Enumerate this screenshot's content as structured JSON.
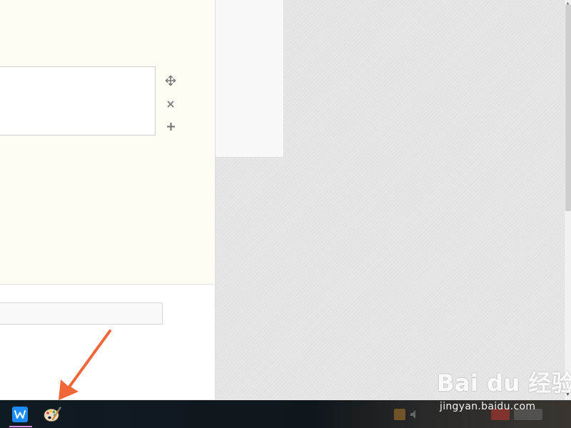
{
  "editor": {
    "title_input": {
      "value": "",
      "placeholder": ""
    },
    "block_tools": [
      {
        "icon": "move-icon",
        "symbol": "✥"
      },
      {
        "icon": "close-icon",
        "symbol": "×"
      },
      {
        "icon": "plus-icon",
        "symbol": "+"
      }
    ]
  },
  "taskbar": {
    "apps": [
      {
        "name": "WPS Writer",
        "icon": "wps-writer-icon",
        "glyph": "W",
        "color": "#1a8cff",
        "active": true
      },
      {
        "name": "Paint",
        "icon": "paint-palette-icon",
        "active": false
      }
    ],
    "active_indicator_color": "#d68ce0"
  },
  "annotation": {
    "arrow_color": "#f0673a"
  },
  "watermark": {
    "logo_text": "Bai du 经验",
    "url": "jingyan.baidu.com"
  }
}
